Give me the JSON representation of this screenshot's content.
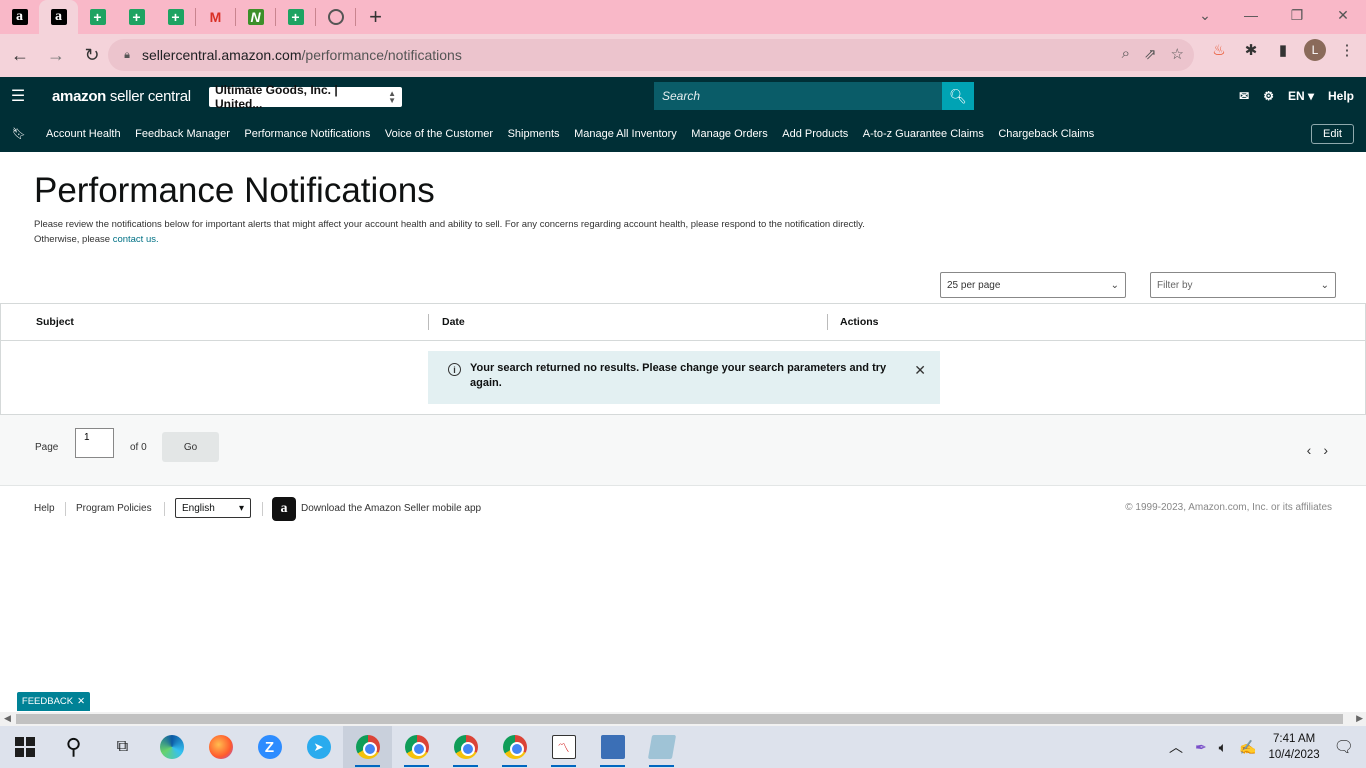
{
  "browser": {
    "tabs": [
      {
        "icon": "amazon-a-icon",
        "glyph": "a"
      },
      {
        "icon": "amazon-a-icon",
        "glyph": "a"
      },
      {
        "icon": "google-sheets-icon",
        "glyph": "+"
      },
      {
        "icon": "google-sheets-icon",
        "glyph": "+"
      },
      {
        "icon": "google-sheets-icon",
        "glyph": "+"
      },
      {
        "icon": "gmail-icon",
        "glyph": "M"
      },
      {
        "icon": "n-app-icon",
        "glyph": "N"
      },
      {
        "icon": "google-sheets-icon",
        "glyph": "+"
      },
      {
        "icon": "globe-icon",
        "glyph": ""
      }
    ],
    "new_tab": "+",
    "url_domain": "sellercentral.amazon.com",
    "url_path": "/performance/notifications",
    "profile_initial": "L"
  },
  "header": {
    "logo_bold": "amazon",
    "logo_rest": " seller central",
    "account": "Ultimate Goods, Inc. | United...",
    "search_placeholder": "Search",
    "language": "EN",
    "help": "Help"
  },
  "nav": {
    "links": [
      "Account Health",
      "Feedback Manager",
      "Performance Notifications",
      "Voice of the Customer",
      "Shipments",
      "Manage All Inventory",
      "Manage Orders",
      "Add Products",
      "A-to-z Guarantee Claims",
      "Chargeback Claims"
    ],
    "edit": "Edit"
  },
  "main": {
    "title": "Performance Notifications",
    "intro": "Please review the notifications below for important alerts that might affect your account health and ability to sell. For any concerns regarding account health, please respond to the notification directly. Otherwise, please ",
    "intro_link": "contact us.",
    "per_page": "25 per page",
    "filter_placeholder": "Filter by",
    "columns": [
      "Subject",
      "Date",
      "Actions"
    ],
    "alert": "Your search returned no results. Please change your search parameters and try again."
  },
  "pager": {
    "page_label": "Page",
    "page_value": "1",
    "of_label": "of 0",
    "go": "Go"
  },
  "footer": {
    "help": "Help",
    "policies": "Program Policies",
    "language": "English",
    "app": "Download the Amazon Seller mobile app",
    "copyright": "© 1999-2023, Amazon.com, Inc. or its affiliates"
  },
  "feedback": "FEEDBACK",
  "taskbar": {
    "time": "7:41 AM",
    "date": "10/4/2023"
  },
  "colors": {
    "header_bg": "#002f36",
    "search_btn": "#00a3b4",
    "link": "#007185",
    "tab_strip": "#f9b8c8"
  }
}
